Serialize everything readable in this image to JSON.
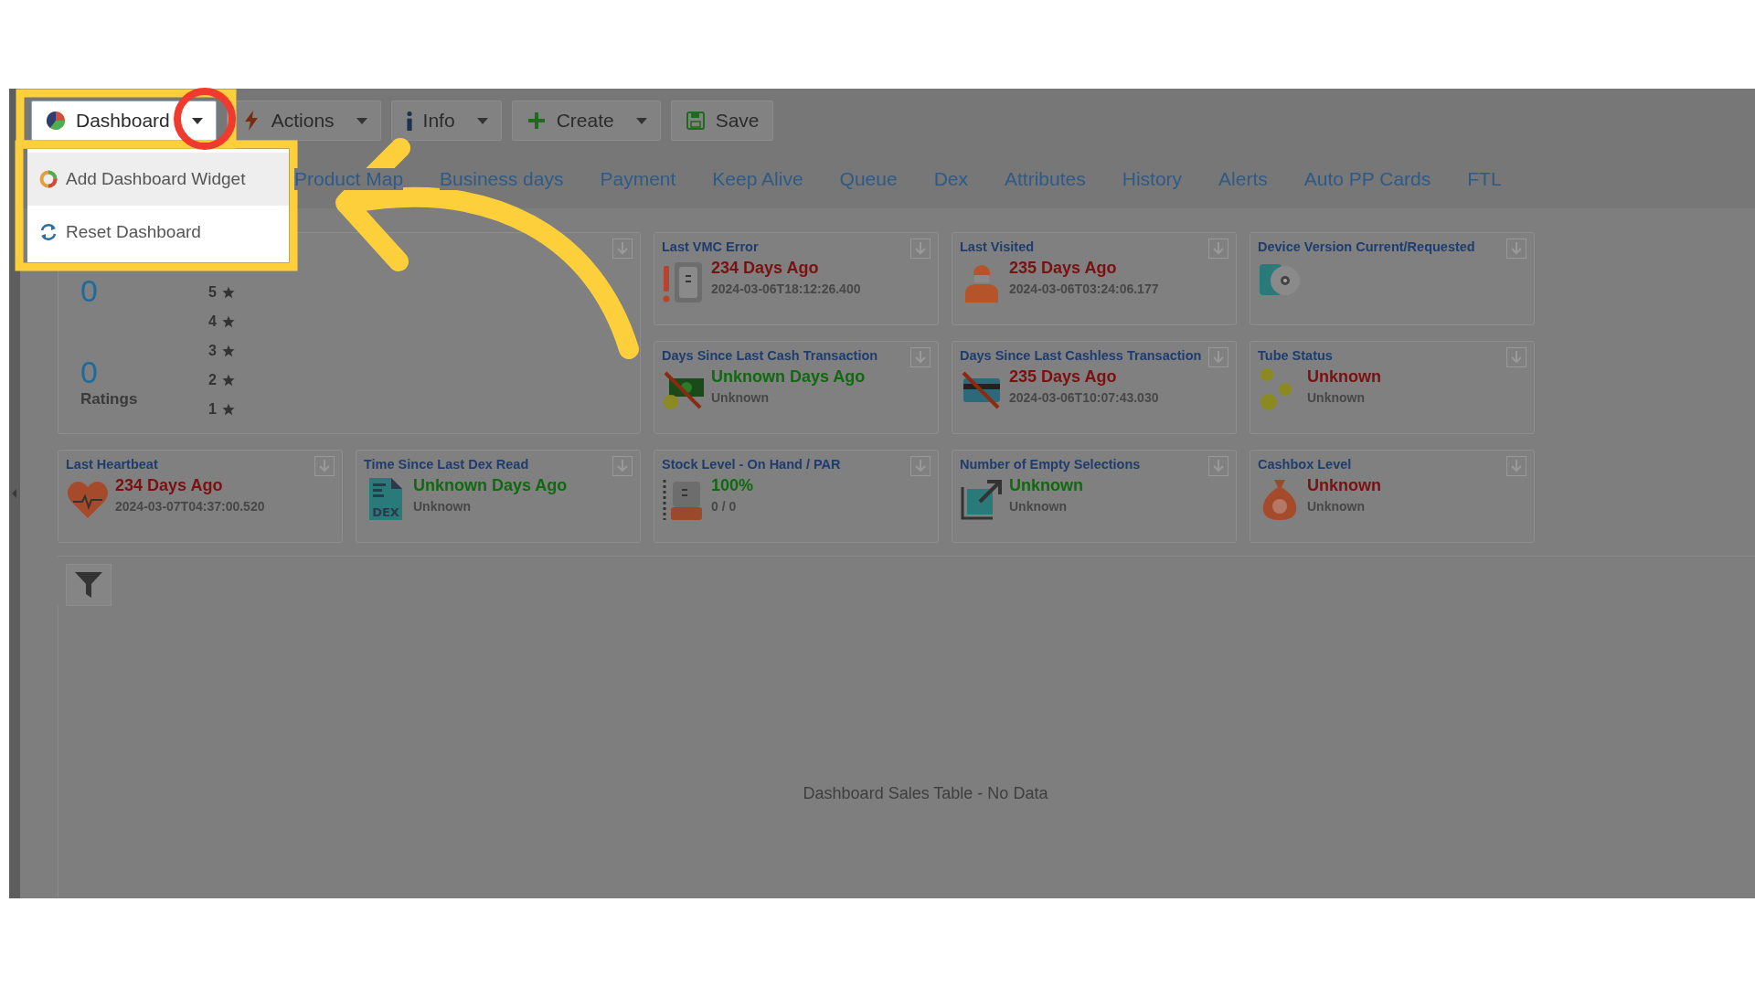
{
  "toolbar": [
    {
      "kind": "dashboard",
      "label": "Dashboard",
      "caret": true
    },
    {
      "kind": "actions",
      "label": "Actions",
      "caret": true
    },
    {
      "kind": "info",
      "label": "Info",
      "caret": true
    },
    {
      "kind": "create",
      "label": "Create",
      "caret": true
    },
    {
      "kind": "save",
      "label": "Save",
      "caret": false
    }
  ],
  "menu": [
    {
      "kind": "add",
      "label": "Add Dashboard Widget",
      "highlighted": true
    },
    {
      "kind": "reset",
      "label": "Reset Dashboard",
      "highlighted": false
    }
  ],
  "tabs": [
    "Product Map",
    "Business days",
    "Payment",
    "Keep Alive",
    "Queue",
    "Dex",
    "Attributes",
    "History",
    "Alerts",
    "Auto PP Cards",
    "FTL"
  ],
  "ratings": {
    "totals": [
      "0",
      "0"
    ],
    "label": "Ratings",
    "stars": [
      "5",
      "4",
      "3",
      "2",
      "1"
    ]
  },
  "widgets": [
    {
      "kind": "vmc_error",
      "title": "Last VMC Error",
      "value": "234 Days Ago",
      "color": "#7a1010",
      "detail": "2024-03-06T18:12:26.400"
    },
    {
      "kind": "visit",
      "title": "Last Visited",
      "value": "235 Days Ago",
      "color": "#7a1010",
      "detail": "2024-03-06T03:24:06.177"
    },
    {
      "kind": "device",
      "title": "Device Version Current/Requested"
    },
    {
      "kind": "cash",
      "title": "Days Since Last Cash Transaction",
      "value": "Unknown Days Ago",
      "color": "#0f6a0f",
      "detail": "Unknown"
    },
    {
      "kind": "cashless",
      "title": "Days Since Last Cashless Transaction",
      "value": "235 Days Ago",
      "color": "#7a1010",
      "detail": "2024-03-06T10:07:43.030"
    },
    {
      "kind": "tubes",
      "title": "Tube Status",
      "value": "Unknown",
      "color": "#7a1010",
      "detail": "Unknown"
    },
    {
      "kind": "heartbeat",
      "title": "Last Heartbeat",
      "value": "234 Days Ago",
      "color": "#7a1010",
      "detail": "2024-03-07T04:37:00.520"
    },
    {
      "kind": "dex",
      "title": "Time Since Last Dex Read",
      "value": "Unknown Days Ago",
      "color": "#0f6a0f",
      "detail": "Unknown",
      "icon_text": "DEX"
    },
    {
      "kind": "stock",
      "title": "Stock Level - On Hand / PAR",
      "value": "100%",
      "color": "#0f6a0f",
      "detail": "0 / 0"
    },
    {
      "kind": "empty",
      "title": "Number of Empty Selections",
      "value": "Unknown",
      "color": "#0f6a0f",
      "detail": "Unknown"
    },
    {
      "kind": "cashbox",
      "title": "Cashbox Level",
      "value": "Unknown",
      "color": "#7a1010",
      "detail": "Unknown"
    }
  ],
  "sales_table": {
    "message": "Dashboard Sales Table - No Data"
  }
}
